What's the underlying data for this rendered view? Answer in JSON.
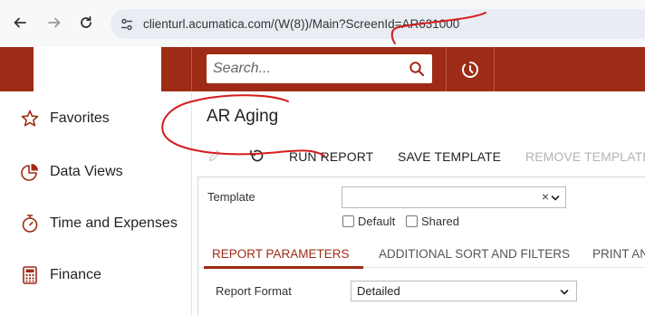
{
  "browser": {
    "url": "clienturl.acumatica.com/(W(8))/Main?ScreenId=AR631000",
    "back_icon": "arrow-left-icon",
    "forward_icon": "arrow-right-icon",
    "reload_icon": "reload-icon",
    "site_info_icon": "tune-icon"
  },
  "header": {
    "search_placeholder": "Search...",
    "brand_color": "#9e2b16"
  },
  "sidebar": {
    "items": [
      {
        "label": "Favorites",
        "icon": "star-icon"
      },
      {
        "label": "Data Views",
        "icon": "pie-chart-icon"
      },
      {
        "label": "Time and Expenses",
        "icon": "stopwatch-icon"
      },
      {
        "label": "Finance",
        "icon": "calculator-icon"
      }
    ]
  },
  "main": {
    "title": "AR Aging",
    "toolbar": {
      "run_report": "RUN REPORT",
      "save_template": "SAVE TEMPLATE",
      "remove_template": "REMOVE TEMPLATE"
    },
    "form": {
      "template_label": "Template",
      "template_value": "",
      "default_label": "Default",
      "shared_label": "Shared",
      "clear_symbol": "×"
    },
    "tabs": [
      {
        "label": "REPORT PARAMETERS",
        "active": true
      },
      {
        "label": "ADDITIONAL SORT AND FILTERS",
        "active": false
      },
      {
        "label": "PRINT AN",
        "active": false
      }
    ],
    "params": {
      "report_format_label": "Report Format",
      "report_format_value": "Detailed"
    }
  }
}
